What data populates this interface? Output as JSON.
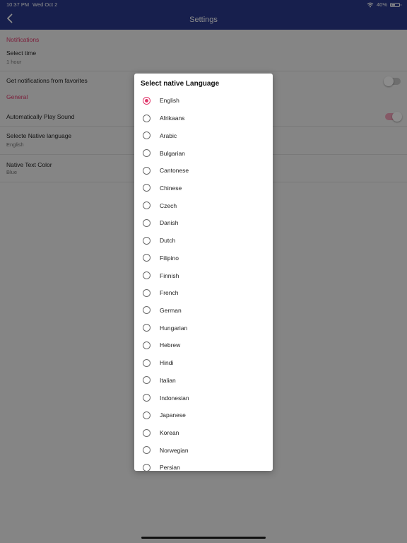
{
  "status_bar": {
    "time": "10:37 PM",
    "date": "Wed Oct 2",
    "battery": "40%"
  },
  "nav": {
    "title": "Settings"
  },
  "settings": {
    "notifications_header": "Notifications",
    "select_time_label": "Select time",
    "select_time_value": "1 hour",
    "favorites_label": "Get notifications from favorites",
    "favorites_enabled": false,
    "general_header": "General",
    "auto_play_label": "Automatically Play Sound",
    "auto_play_enabled": true,
    "native_language_label": "Selecte Native language",
    "native_language_value": "English",
    "native_color_label": "Native Text Color",
    "native_color_value": "Blue"
  },
  "dialog": {
    "title": "Select native Language",
    "selected": "English",
    "languages": [
      "English",
      "Afrikaans",
      "Arabic",
      "Bulgarian",
      "Cantonese",
      "Chinese",
      "Czech",
      "Danish",
      "Dutch",
      "Filipino",
      "Finnish",
      "French",
      "German",
      "Hungarian",
      "Hebrew",
      "Hindi",
      "Italian",
      "Indonesian",
      "Japanese",
      "Korean",
      "Norwegian",
      "Persian"
    ]
  },
  "colors": {
    "nav_bar": "#2b3a8c",
    "accent": "#e0386b",
    "background": "#f3f3f3"
  }
}
